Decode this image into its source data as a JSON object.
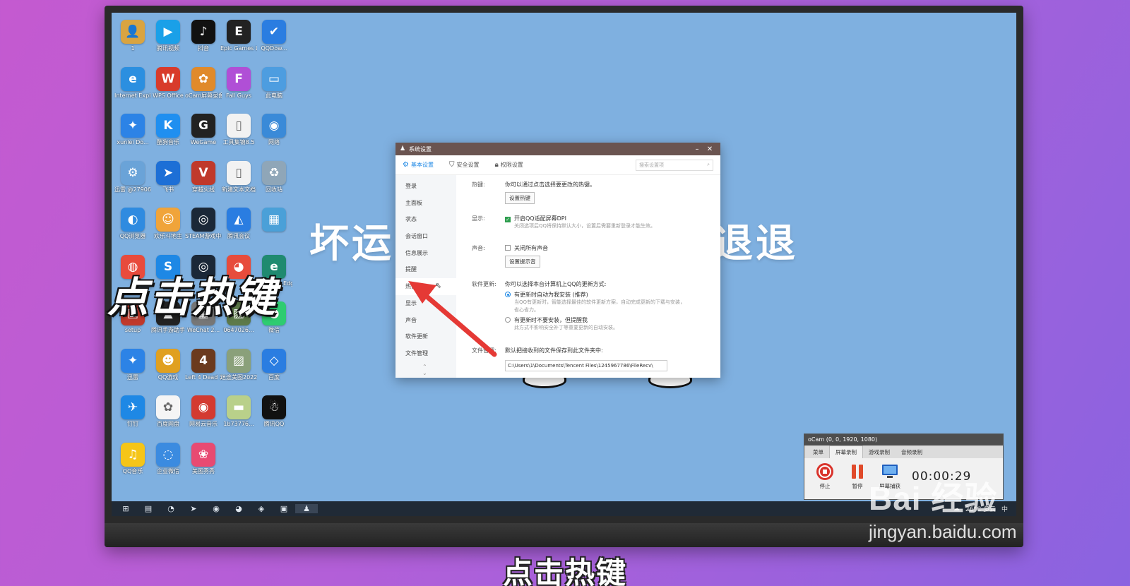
{
  "desktop": {
    "icons": [
      {
        "label": "1",
        "glyph": "👤",
        "color": "#d9a441"
      },
      {
        "label": "腾讯视频",
        "glyph": "▶",
        "color": "#1aa0e8"
      },
      {
        "label": "抖音",
        "glyph": "♪",
        "color": "#111111"
      },
      {
        "label": "Epic Games Launcher",
        "glyph": "E",
        "color": "#222222"
      },
      {
        "label": "QQDow...",
        "glyph": "✔",
        "color": "#2a7de1"
      },
      {
        "label": "Internet Explorer",
        "glyph": "e",
        "color": "#2b8fe0"
      },
      {
        "label": "WPS Office",
        "glyph": "W",
        "color": "#d83b2b"
      },
      {
        "label": "oCam屏幕录像",
        "glyph": "✿",
        "color": "#e08a2b"
      },
      {
        "label": "Fall Guys",
        "glyph": "F",
        "color": "#b04fd6"
      },
      {
        "label": "此电脑",
        "glyph": "▭",
        "color": "#4d9de0"
      },
      {
        "label": "xunlei Do...",
        "glyph": "✦",
        "color": "#2c83e6"
      },
      {
        "label": "酷狗音乐",
        "glyph": "K",
        "color": "#1f8ff0"
      },
      {
        "label": "WeGame",
        "glyph": "G",
        "color": "#222222"
      },
      {
        "label": "工具集锦8.5",
        "glyph": "▯",
        "color": "#f2f2f2"
      },
      {
        "label": "网络",
        "glyph": "◉",
        "color": "#3a8ad8"
      },
      {
        "label": "迅雷 @27906...",
        "glyph": "⚙",
        "color": "#6aa3d8"
      },
      {
        "label": "飞书",
        "glyph": "➤",
        "color": "#1d6fd6"
      },
      {
        "label": "穿越火线",
        "glyph": "V",
        "color": "#c0392b"
      },
      {
        "label": "新建文本文档",
        "glyph": "▯",
        "color": "#f2f2f2"
      },
      {
        "label": "回收站",
        "glyph": "♻",
        "color": "#8fa6b8"
      },
      {
        "label": "QQ浏览器",
        "glyph": "◐",
        "color": "#2f8be0"
      },
      {
        "label": "欢乐斗地主",
        "glyph": "☺",
        "color": "#f0a43a"
      },
      {
        "label": "STEAM游戏中心",
        "glyph": "◎",
        "color": "#1b2838"
      },
      {
        "label": "腾讯会议",
        "glyph": "◭",
        "color": "#2a7de1"
      },
      {
        "label": "",
        "glyph": "▦",
        "color": "#4aa0d8"
      },
      {
        "label": "",
        "glyph": "◍",
        "color": "#e84b3c"
      },
      {
        "label": "",
        "glyph": "S",
        "color": "#1e88e5"
      },
      {
        "label": "",
        "glyph": "◎",
        "color": "#1b2838"
      },
      {
        "label": "",
        "glyph": "◕",
        "color": "#e74c3c"
      },
      {
        "label": "Microsoft Edge",
        "glyph": "e",
        "color": "#1f8a70"
      },
      {
        "label": "setup",
        "glyph": "▣",
        "color": "#c0392b"
      },
      {
        "label": "腾讯手游助手",
        "glyph": "▲",
        "color": "#222222"
      },
      {
        "label": "WeChat 2...",
        "glyph": "▦",
        "color": "#777777"
      },
      {
        "label": "0647026...",
        "glyph": "▨",
        "color": "#5d7a4a"
      },
      {
        "label": "微信",
        "glyph": "◕",
        "color": "#2ecc71"
      },
      {
        "label": "迅雷",
        "glyph": "✦",
        "color": "#2c83e6"
      },
      {
        "label": "QQ游戏",
        "glyph": "☻",
        "color": "#e0a020"
      },
      {
        "label": "Left 4 Dead 2",
        "glyph": "4",
        "color": "#6b3a1e"
      },
      {
        "label": "迷途美图20220...",
        "glyph": "▨",
        "color": "#8aa07a"
      },
      {
        "label": "百度",
        "glyph": "◇",
        "color": "#2a7de1"
      },
      {
        "label": "钉钉",
        "glyph": "✈",
        "color": "#1e88e5"
      },
      {
        "label": "百度网盘",
        "glyph": "✿",
        "color": "#f5f5f5"
      },
      {
        "label": "网易云音乐",
        "glyph": "◉",
        "color": "#d33a31"
      },
      {
        "label": "1b73776...",
        "glyph": "▬",
        "color": "#b9d08a"
      },
      {
        "label": "腾讯QQ",
        "glyph": "☃",
        "color": "#111111"
      },
      {
        "label": "QQ音乐",
        "glyph": "♫",
        "color": "#f5c518"
      },
      {
        "label": "企业微信",
        "glyph": "◌",
        "color": "#3b8be0"
      },
      {
        "label": "美图秀秀",
        "glyph": "❀",
        "color": "#e84a72"
      }
    ],
    "bg_text_left": "坏运",
    "bg_text_right": "退退"
  },
  "dialog": {
    "title": "系统设置",
    "tabs": [
      {
        "label": "基本设置",
        "icon": "gear-icon"
      },
      {
        "label": "安全设置",
        "icon": "shield-icon"
      },
      {
        "label": "权限设置",
        "icon": "lock-icon"
      }
    ],
    "search_placeholder": "搜索设置项",
    "nav": [
      "登录",
      "主面板",
      "状态",
      "会话窗口",
      "信息展示",
      "提醒",
      "热键",
      "显示",
      "声音",
      "软件更新",
      "文件管理"
    ],
    "active_nav": "热键",
    "hotkey": {
      "key": "热键:",
      "desc": "你可以通过点击选择要更改的热键。",
      "button": "设置热键"
    },
    "display": {
      "key": "显示:",
      "checkbox": "开启QQ适配屏幕DPI",
      "checked": true,
      "hint": "关闭选项后QQ将保持默认大小，设置后需要重新登录才能生效。"
    },
    "sound": {
      "key": "声音:",
      "checkbox": "关闭所有声音",
      "checked": false,
      "button": "设置提示音"
    },
    "update": {
      "key": "软件更新:",
      "desc": "你可以选择本台计算机上QQ的更新方式:",
      "option1": "有更新时自动为我安装 (推荐)",
      "option1_hint": "当QQ有更新时，智能选择最佳的软件更新方案，自动完成更新的下载与安装，省心省力。",
      "option2": "有更新时不要安装，但提醒我",
      "option2_hint": "此方式不影响安全补丁等重要更新的自动安装。"
    },
    "files": {
      "key": "文件管理:",
      "desc": "默认把接收到的文件保存到此文件夹中:",
      "path": "C:\\Users\\1\\Documents\\Tencent Files\\1245967786\\FileRecv\\"
    }
  },
  "taskbar": {
    "icons": [
      "windows-icon",
      "file-explorer-icon",
      "edge-icon",
      "feishu-icon",
      "sogou-icon",
      "wechat-icon",
      "app-icon",
      "screenshot-icon",
      "qq-icon"
    ],
    "weather": "26°C 多云",
    "ime": "中"
  },
  "ocam": {
    "title": "oCam (0, 0, 1920, 1080)",
    "tabs": [
      "菜单",
      "屏幕录制",
      "游戏录制",
      "音频录制"
    ],
    "active_tab": "屏幕录制",
    "buttons": [
      "停止",
      "暂停",
      "屏幕捕获"
    ],
    "timer": "00:00:29"
  },
  "overlay": {
    "caption": "点击热键",
    "subtitle": "点击热键",
    "watermark_logo": "Bai 经验",
    "watermark_url": "jingyan.baidu.com"
  },
  "colors": {
    "accent": "#1e88e5",
    "dialog_title_bar": "#6a5450",
    "arrow": "#e53935",
    "desktop_bg": "#7fb0e0"
  }
}
